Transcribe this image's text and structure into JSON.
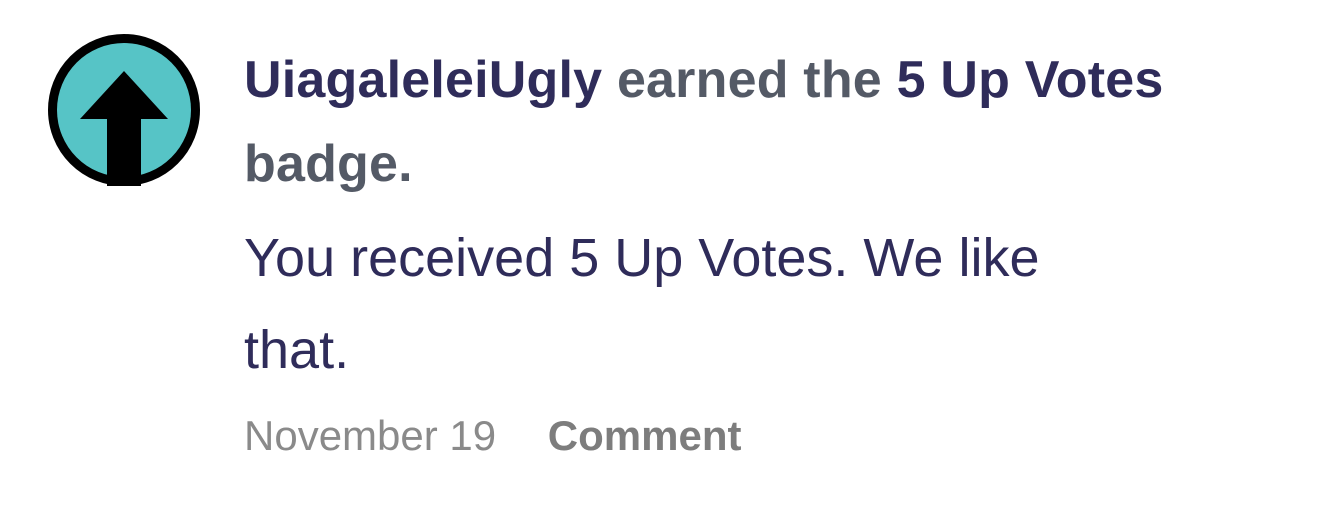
{
  "notification": {
    "badge_icon": "up-arrow-badge-icon",
    "username": "UiagaleleiUgly",
    "earned_text": "earned the",
    "badge_name": "5 Up Votes",
    "badge_suffix": "badge.",
    "message": "You received 5 Up Votes. We like that.",
    "date": "November 19",
    "comment_label": "Comment"
  },
  "colors": {
    "badge_fill": "#56c4c6",
    "badge_ring": "#000000",
    "arrow": "#000000",
    "link_text": "#2f2c5a",
    "secondary_text": "#545a66",
    "meta_text": "#8a8a8a"
  }
}
